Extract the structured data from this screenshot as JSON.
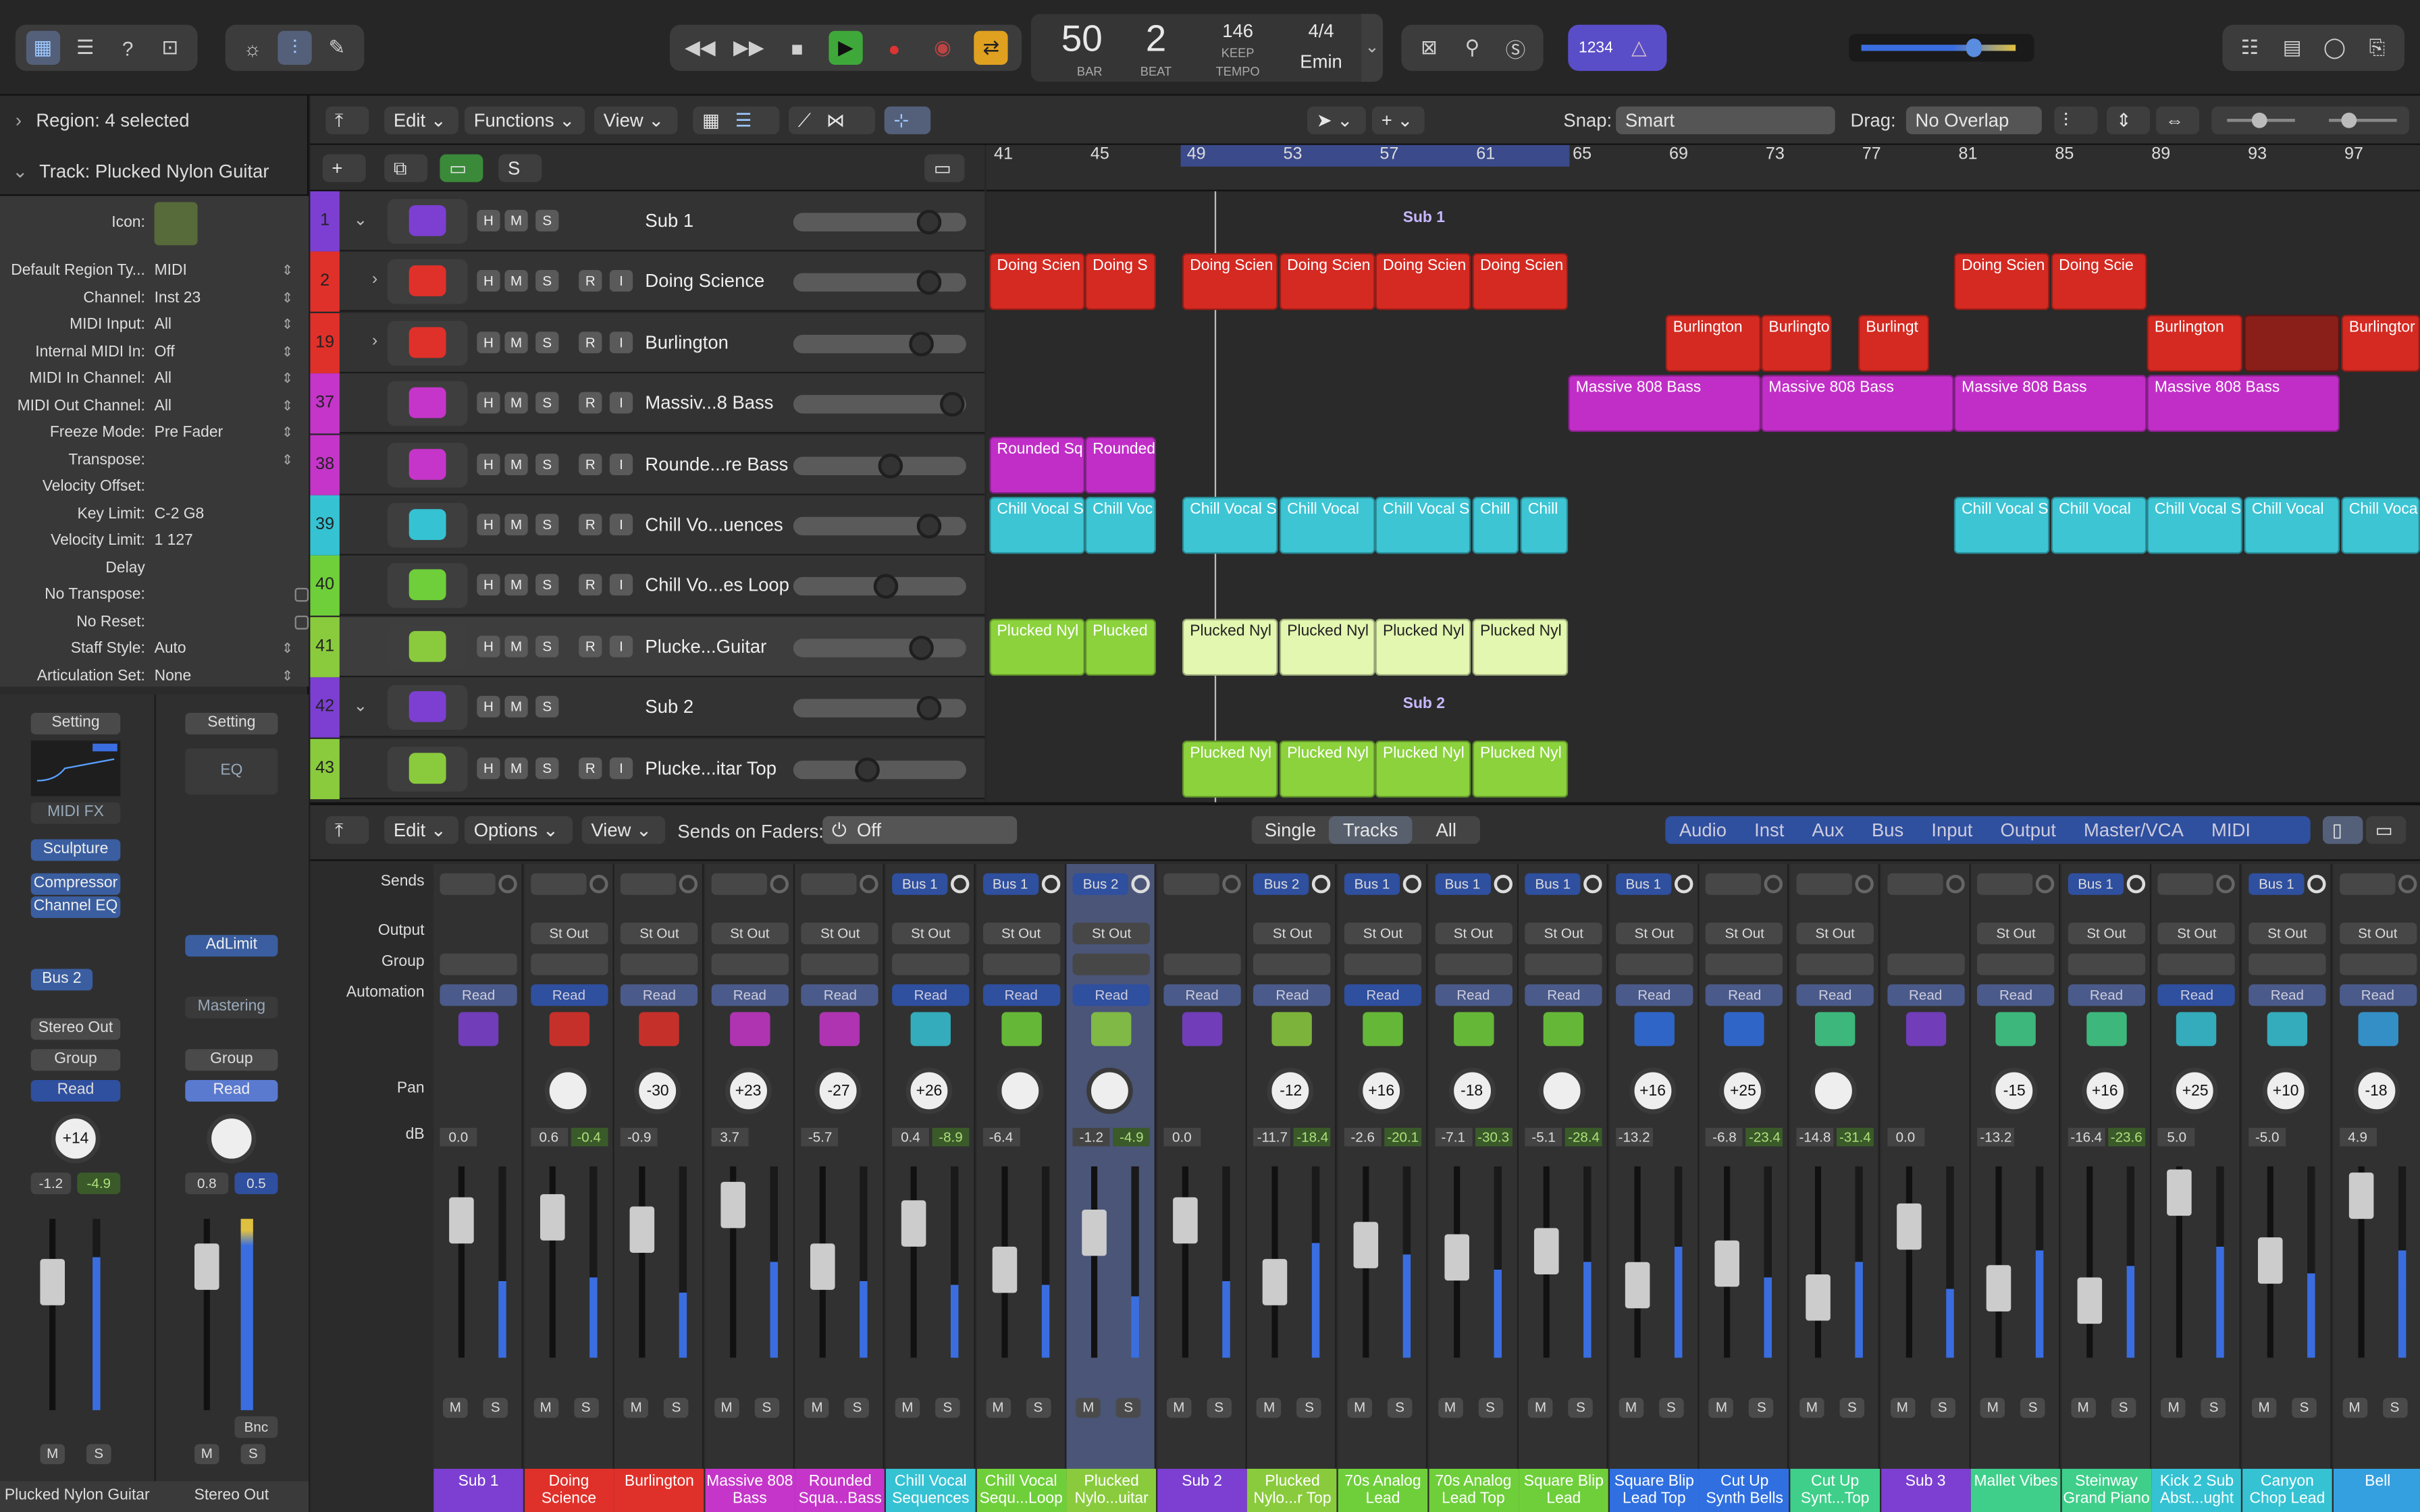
{
  "transport": {
    "bar": "50",
    "beat": "2",
    "bar_label": "BAR",
    "beat_label": "BEAT",
    "tempo": "146",
    "tempo_label": "TEMPO",
    "keep": "KEEP",
    "sig": "4/4",
    "key": "Emin",
    "counter": "1234"
  },
  "inspector": {
    "region": "Region: 4 selected",
    "track": "Track:  Plucked Nylon Guitar",
    "icon_label": "Icon:",
    "rows": [
      {
        "k": "Default Region Ty...",
        "v": "MIDI"
      },
      {
        "k": "Channel:",
        "v": "Inst 23"
      },
      {
        "k": "MIDI Input:",
        "v": "All"
      },
      {
        "k": "Internal MIDI In:",
        "v": "Off"
      },
      {
        "k": "MIDI In Channel:",
        "v": "All"
      },
      {
        "k": "MIDI Out Channel:",
        "v": "All"
      },
      {
        "k": "Freeze Mode:",
        "v": "Pre Fader"
      },
      {
        "k": "Transpose:",
        "v": ""
      },
      {
        "k": "Velocity Offset:",
        "v": ""
      },
      {
        "k": "Key Limit:",
        "v": "C-2  G8"
      },
      {
        "k": "Velocity Limit:",
        "v": "1  127"
      },
      {
        "k": "Delay",
        "v": ""
      },
      {
        "k": "No Transpose:",
        "v": ""
      },
      {
        "k": "No Reset:",
        "v": ""
      },
      {
        "k": "Staff Style:",
        "v": "Auto"
      },
      {
        "k": "Articulation Set:",
        "v": "None"
      }
    ],
    "strip1": {
      "setting": "Setting",
      "midifx": "MIDI FX",
      "plugin": "Sculpture",
      "fx1": "Compressor",
      "fx2": "Channel EQ",
      "send": "Bus 2",
      "out": "Stereo Out",
      "group": "Group",
      "read": "Read",
      "pan": "+14",
      "db1": "-1.2",
      "db2": "-4.9",
      "m": "M",
      "s": "S",
      "name": "Plucked Nylon Guitar"
    },
    "strip2": {
      "setting": "Setting",
      "eq": "EQ",
      "fx1": "AdLimit",
      "mastering": "Mastering",
      "group": "Group",
      "read": "Read",
      "db1": "0.8",
      "db2": "0.5",
      "bnc": "Bnc",
      "m": "M",
      "s": "S",
      "name": "Stereo Out"
    }
  },
  "arrange": {
    "menus": [
      "Edit",
      "Functions",
      "View"
    ],
    "snap_label": "Snap:",
    "snap": "Smart",
    "drag_label": "Drag:",
    "drag": "No Overlap",
    "s": "S",
    "ruler": [
      "41",
      "45",
      "49",
      "53",
      "57",
      "61",
      "65",
      "69",
      "73",
      "77",
      "81",
      "85",
      "89",
      "93",
      "97"
    ],
    "tracks": [
      {
        "num": "1",
        "name": "Sub 1",
        "color": "#7c3fd1",
        "rec": false,
        "folder": true
      },
      {
        "num": "2",
        "name": "Doing Science",
        "color": "#e0302a",
        "rec": true
      },
      {
        "num": "19",
        "name": "Burlington",
        "color": "#e0302a",
        "rec": true
      },
      {
        "num": "37",
        "name": "Massiv...8 Bass",
        "color": "#c535c9",
        "rec": true
      },
      {
        "num": "38",
        "name": "Rounde...re Bass",
        "color": "#c535c9",
        "rec": true
      },
      {
        "num": "39",
        "name": "Chill Vo...uences",
        "color": "#35c2d3",
        "rec": true
      },
      {
        "num": "40",
        "name": "Chill Vo...es Loop",
        "color": "#6fcf3a",
        "rec": true
      },
      {
        "num": "41",
        "name": "Plucke...Guitar",
        "color": "#8acb3d",
        "rec": true
      },
      {
        "num": "42",
        "name": "Sub 2",
        "color": "#7c3fd1",
        "rec": false,
        "folder": true
      },
      {
        "num": "43",
        "name": "Plucke...itar Top",
        "color": "#8acb3d",
        "rec": true
      }
    ],
    "folder_labels": [
      "Sub 1",
      "Sub 2"
    ],
    "regions": {
      "doing": [
        "Doing Scien",
        "Doing S",
        "Doing Scien",
        "Doing Scien",
        "Doing Scien",
        "Doing Scien",
        "Doing Scien",
        "Doing Scie"
      ],
      "burl": [
        "Burlington",
        "Burlingto",
        "Burlingt",
        "Burlington",
        "",
        "Burlingtor"
      ],
      "massive": [
        "Massive 808 Bass",
        "Massive 808 Bass",
        "Massive 808 Bass",
        "Massive 808 Bass"
      ],
      "rounded": [
        "Rounded Sq",
        "Rounded"
      ],
      "chill": [
        "Chill Vocal S",
        "Chill Voc",
        "Chill Vocal S",
        "Chill Vocal",
        "Chill Vocal S",
        "Chill",
        "Chill",
        "Chill Vocal S",
        "Chill Vocal",
        "Chill Vocal S",
        "Chill Vocal",
        "Chill Voca"
      ],
      "pluck": [
        "Plucked Nyl",
        "Plucked",
        "Plucked Nyl",
        "Plucked Nyl",
        "Plucked Nyl",
        "Plucked Nyl"
      ],
      "pluck2": [
        "Plucked Nyl",
        "Plucked Nyl",
        "Plucked Nyl",
        "Plucked Nyl"
      ]
    }
  },
  "mixer": {
    "menus": [
      "Edit",
      "Options",
      "View"
    ],
    "sends_label": "Sends on Faders:",
    "sends_value": "Off",
    "view_tabs": [
      "Single",
      "Tracks",
      "All"
    ],
    "filters": [
      "Audio",
      "Inst",
      "Aux",
      "Bus",
      "Input",
      "Output",
      "Master/VCA",
      "MIDI"
    ],
    "row_labels": [
      "Sends",
      "Output",
      "Group",
      "Automation",
      "Pan",
      "dB"
    ],
    "channels": [
      {
        "name": "Sub 1",
        "color": "#7c3fd1",
        "send": "",
        "out": "",
        "read": "Read",
        "pan": "",
        "db": "0.0",
        "db2": ""
      },
      {
        "name": "Doing Science",
        "color": "#e0302a",
        "send": "",
        "out": "St Out",
        "read": "Read",
        "pan": "",
        "db": "0.6",
        "db2": "-0.4"
      },
      {
        "name": "Burlington",
        "color": "#e0302a",
        "send": "",
        "out": "St Out",
        "read": "Read",
        "pan": "-30",
        "db": "-0.9",
        "db2": ""
      },
      {
        "name": "Massive 808 Bass",
        "color": "#c535c9",
        "send": "",
        "out": "St Out",
        "read": "Read",
        "pan": "+23",
        "db": "3.7",
        "db2": ""
      },
      {
        "name": "Rounded Squa...Bass",
        "color": "#c535c9",
        "send": "",
        "out": "St Out",
        "read": "Read",
        "pan": "-27",
        "db": "-5.7",
        "db2": ""
      },
      {
        "name": "Chill Vocal Sequences",
        "color": "#35c2d3",
        "send": "Bus 1",
        "out": "St Out",
        "read": "Read",
        "pan": "+26",
        "db": "0.4",
        "db2": "-8.9"
      },
      {
        "name": "Chill Vocal Sequ...Loop",
        "color": "#6fcf3a",
        "send": "Bus 1",
        "out": "St Out",
        "read": "Read",
        "pan": "",
        "db": "-6.4",
        "db2": ""
      },
      {
        "name": "Plucked Nylo...uitar",
        "color": "#8acb3d",
        "send": "Bus 2",
        "out": "St Out",
        "read": "Read",
        "pan": "",
        "db": "-1.2",
        "db2": "-4.9"
      },
      {
        "name": "Sub 2",
        "color": "#7c3fd1",
        "send": "",
        "out": "",
        "read": "Read",
        "pan": "",
        "db": "0.0",
        "db2": ""
      },
      {
        "name": "Plucked Nylo...r Top",
        "color": "#8acb3d",
        "send": "Bus 2",
        "out": "St Out",
        "read": "Read",
        "pan": "-12",
        "db": "-11.7",
        "db2": "-18.4"
      },
      {
        "name": "70s Analog Lead",
        "color": "#6fcf3a",
        "send": "Bus 1",
        "out": "St Out",
        "read": "Read",
        "pan": "+16",
        "db": "-2.6",
        "db2": "-20.1"
      },
      {
        "name": "70s Analog Lead Top",
        "color": "#6fcf3a",
        "send": "Bus 1",
        "out": "St Out",
        "read": "Read",
        "pan": "-18",
        "db": "-7.1",
        "db2": "-30.3"
      },
      {
        "name": "Square Blip Lead",
        "color": "#6fcf3a",
        "send": "Bus 1",
        "out": "St Out",
        "read": "Read",
        "pan": "",
        "db": "-5.1",
        "db2": "-28.4"
      },
      {
        "name": "Square Blip Lead Top",
        "color": "#2f6fe0",
        "send": "Bus 1",
        "out": "St Out",
        "read": "Read",
        "pan": "+16",
        "db": "-13.2",
        "db2": ""
      },
      {
        "name": "Cut Up Synth Bells",
        "color": "#2f6fe0",
        "send": "",
        "out": "St Out",
        "read": "Read",
        "pan": "+25",
        "db": "-6.8",
        "db2": "-23.4"
      },
      {
        "name": "Cut Up Synt...Top",
        "color": "#3fcf8a",
        "send": "",
        "out": "St Out",
        "read": "Read",
        "pan": "",
        "db": "-14.8",
        "db2": "-31.4"
      },
      {
        "name": "Sub 3",
        "color": "#7c3fd1",
        "send": "",
        "out": "",
        "read": "Read",
        "pan": "",
        "db": "0.0",
        "db2": ""
      },
      {
        "name": "Mallet Vibes",
        "color": "#3fcf8a",
        "send": "",
        "out": "St Out",
        "read": "Read",
        "pan": "-15",
        "db": "-13.2",
        "db2": ""
      },
      {
        "name": "Steinway Grand Piano",
        "color": "#3fcf8a",
        "send": "Bus 1",
        "out": "St Out",
        "read": "Read",
        "pan": "+16",
        "db": "-16.4",
        "db2": "-23.6"
      },
      {
        "name": "Kick 2 Sub Abst...ught",
        "color": "#35c2d3",
        "send": "",
        "out": "St Out",
        "read": "Read",
        "pan": "+25",
        "db": "5.0",
        "db2": ""
      },
      {
        "name": "Canyon Chop Lead",
        "color": "#35c2d3",
        "send": "Bus 1",
        "out": "St Out",
        "read": "Read",
        "pan": "+10",
        "db": "-5.0",
        "db2": ""
      },
      {
        "name": "Bell",
        "color": "#35a0e0",
        "send": "",
        "out": "St Out",
        "read": "Read",
        "pan": "-18",
        "db": "4.9",
        "db2": ""
      }
    ],
    "m": "M",
    "s": "S"
  },
  "colors": {
    "accent": "#7aa6ff",
    "play": "#3fa83a",
    "cycle": "#e0a020",
    "record": "#d33"
  }
}
